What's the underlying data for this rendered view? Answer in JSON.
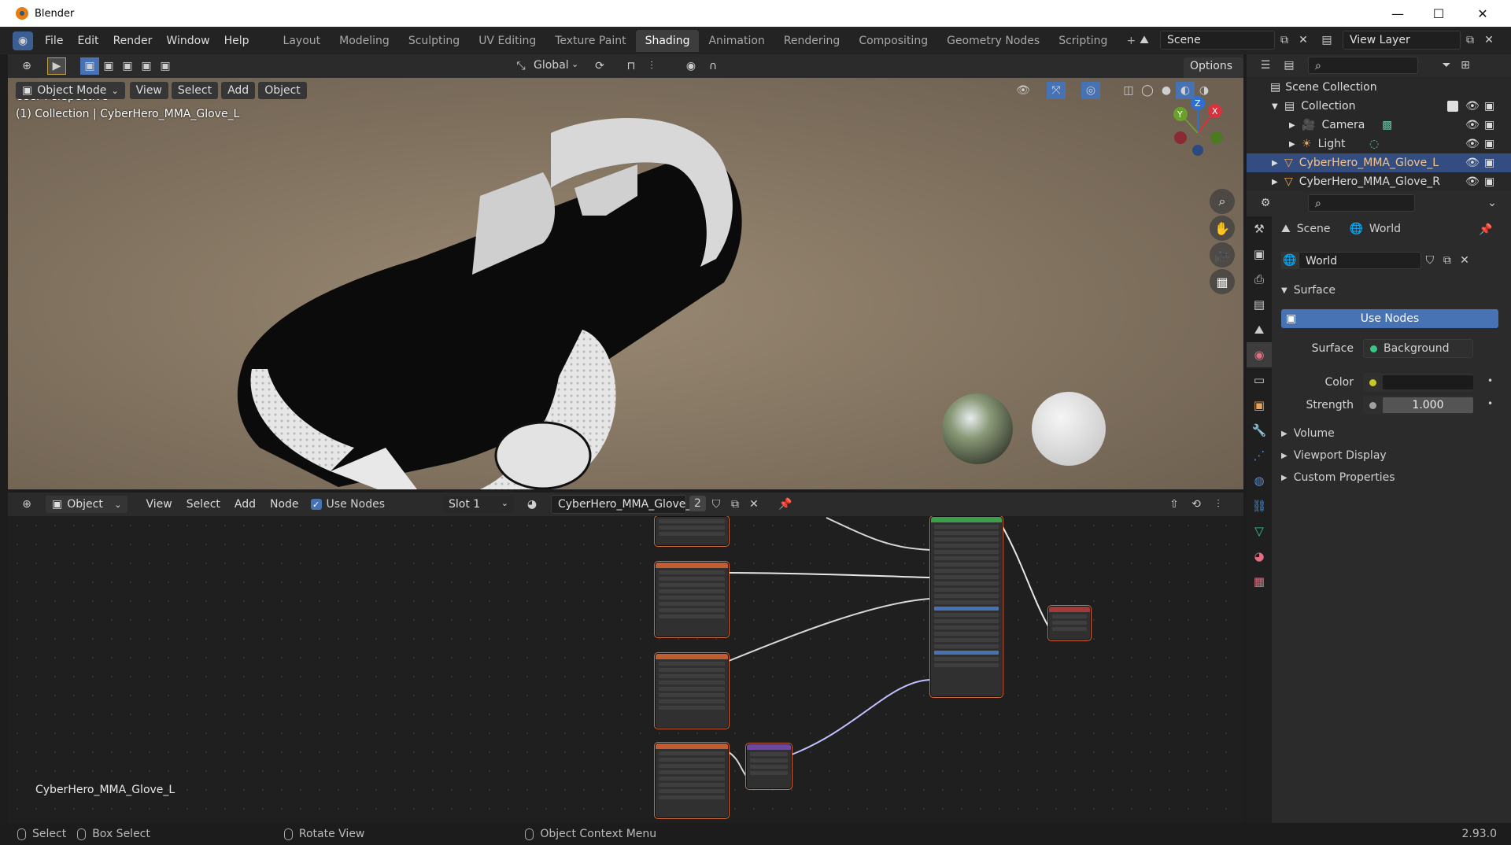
{
  "window": {
    "title": "Blender",
    "min": "—",
    "max": "☐",
    "close": "✕"
  },
  "menu": [
    "File",
    "Edit",
    "Render",
    "Window",
    "Help"
  ],
  "workspaces": [
    "Layout",
    "Modeling",
    "Sculpting",
    "UV Editing",
    "Texture Paint",
    "Shading",
    "Animation",
    "Rendering",
    "Compositing",
    "Geometry Nodes",
    "Scripting"
  ],
  "active_workspace": "Shading",
  "scene": {
    "name": "Scene",
    "view_layer": "View Layer"
  },
  "viewport": {
    "transform_orientation": "Global",
    "options_label": "Options",
    "mode": "Object Mode",
    "menus": [
      "View",
      "Select",
      "Add",
      "Object"
    ],
    "perspective_label": "User Perspective",
    "collection_label": "(1) Collection | CyberHero_MMA_Glove_L",
    "gizmo": {
      "x": "X",
      "y": "Y",
      "z": "Z"
    }
  },
  "node_editor": {
    "type": "Object",
    "menus": [
      "View",
      "Select",
      "Add",
      "Node"
    ],
    "use_nodes_label": "Use Nodes",
    "use_nodes_checked": true,
    "slot": "Slot 1",
    "material": "CyberHero_MMA_Glove_L",
    "users": "2",
    "object_label": "CyberHero_MMA_Glove_L"
  },
  "outliner": {
    "root": "Scene Collection",
    "items": [
      {
        "label": "Collection",
        "indent": 1,
        "icon": "collection-icon"
      },
      {
        "label": "Camera",
        "indent": 2,
        "icon": "camera-icon"
      },
      {
        "label": "Light",
        "indent": 2,
        "icon": "light-icon"
      },
      {
        "label": "CyberHero_MMA_Glove_L",
        "indent": 1,
        "icon": "mesh-icon",
        "selected": true
      },
      {
        "label": "CyberHero_MMA_Glove_R",
        "indent": 1,
        "icon": "mesh-icon"
      }
    ]
  },
  "properties": {
    "breadcrumb_scene": "Scene",
    "breadcrumb_world": "World",
    "world_name": "World",
    "panel_surface": "Surface",
    "use_nodes_button": "Use Nodes",
    "surface_label": "Surface",
    "surface_value": "Background",
    "color_label": "Color",
    "strength_label": "Strength",
    "strength_value": "1.000",
    "panels": [
      "Volume",
      "Viewport Display",
      "Custom Properties"
    ]
  },
  "status": {
    "select": "Select",
    "box_select": "Box Select",
    "rotate_view": "Rotate View",
    "context_menu": "Object Context Menu",
    "version": "2.93.0"
  },
  "colors": {
    "accent": "#4772b3",
    "selected_row": "#334d80",
    "active_tab": "#3d3d3d"
  }
}
